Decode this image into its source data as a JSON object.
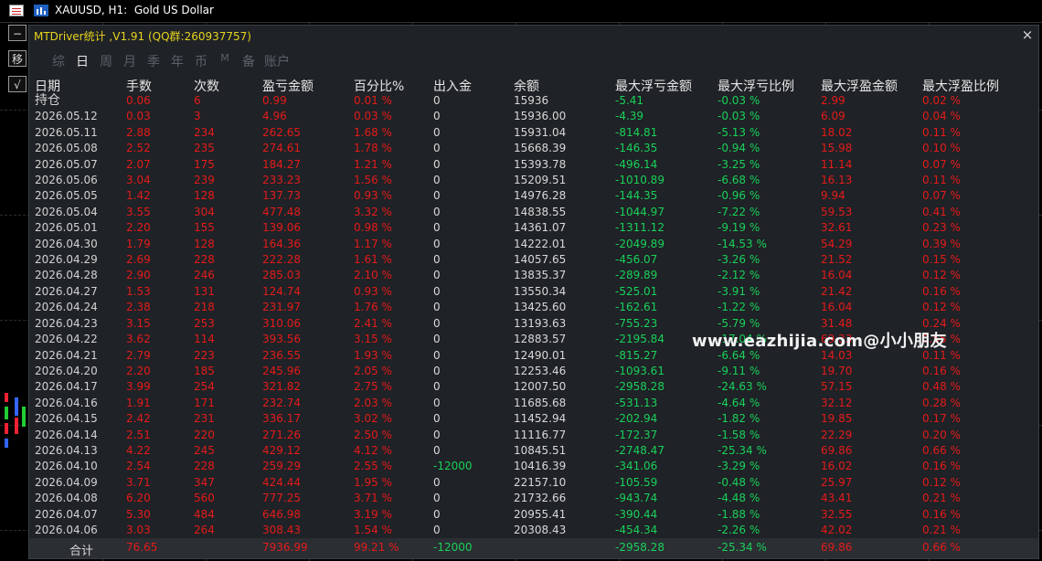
{
  "window": {
    "title": "XAUUSD, H1:  Gold US Dollar"
  },
  "sidebar_buttons": [
    "−",
    "移",
    "√"
  ],
  "panel": {
    "title": "MTDriver统计 ,V1.91 (QQ群:260937757)",
    "close_symbol": "×",
    "tabs": [
      "综",
      "日",
      "周",
      "月",
      "季",
      "年",
      "币",
      "M",
      "备",
      "账户"
    ],
    "active_tab": 1
  },
  "table": {
    "headers": [
      "日期",
      "手数",
      "次数",
      "盈亏金额",
      "百分比%",
      "出入金",
      "余额",
      "最大浮亏金额",
      "最大浮亏比例",
      "最大浮盈金额",
      "最大浮盈比例"
    ],
    "rows": [
      [
        "持仓",
        "0.06",
        "6",
        "0.99",
        "0.01 %",
        "0",
        "15936",
        "-5.41",
        "-0.03 %",
        "2.99",
        "0.02 %"
      ],
      [
        "2026.05.12",
        "0.03",
        "3",
        "4.96",
        "0.03 %",
        "0",
        "15936.00",
        "-4.39",
        "-0.03 %",
        "6.09",
        "0.04 %"
      ],
      [
        "2026.05.11",
        "2.88",
        "234",
        "262.65",
        "1.68 %",
        "0",
        "15931.04",
        "-814.81",
        "-5.13 %",
        "18.02",
        "0.11 %"
      ],
      [
        "2026.05.08",
        "2.52",
        "235",
        "274.61",
        "1.78 %",
        "0",
        "15668.39",
        "-146.35",
        "-0.94 %",
        "15.98",
        "0.10 %"
      ],
      [
        "2026.05.07",
        "2.07",
        "175",
        "184.27",
        "1.21 %",
        "0",
        "15393.78",
        "-496.14",
        "-3.25 %",
        "11.14",
        "0.07 %"
      ],
      [
        "2026.05.06",
        "3.04",
        "239",
        "233.23",
        "1.56 %",
        "0",
        "15209.51",
        "-1010.89",
        "-6.68 %",
        "16.13",
        "0.11 %"
      ],
      [
        "2026.05.05",
        "1.42",
        "128",
        "137.73",
        "0.93 %",
        "0",
        "14976.28",
        "-144.35",
        "-0.96 %",
        "9.94",
        "0.07 %"
      ],
      [
        "2026.05.04",
        "3.55",
        "304",
        "477.48",
        "3.32 %",
        "0",
        "14838.55",
        "-1044.97",
        "-7.22 %",
        "59.53",
        "0.41 %"
      ],
      [
        "2026.05.01",
        "2.20",
        "155",
        "139.06",
        "0.98 %",
        "0",
        "14361.07",
        "-1311.12",
        "-9.19 %",
        "32.61",
        "0.23 %"
      ],
      [
        "2026.04.30",
        "1.79",
        "128",
        "164.36",
        "1.17 %",
        "0",
        "14222.01",
        "-2049.89",
        "-14.53 %",
        "54.29",
        "0.39 %"
      ],
      [
        "2026.04.29",
        "2.69",
        "228",
        "222.28",
        "1.61 %",
        "0",
        "14057.65",
        "-456.07",
        "-3.26 %",
        "21.52",
        "0.15 %"
      ],
      [
        "2026.04.28",
        "2.90",
        "246",
        "285.03",
        "2.10 %",
        "0",
        "13835.37",
        "-289.89",
        "-2.12 %",
        "16.04",
        "0.12 %"
      ],
      [
        "2026.04.27",
        "1.53",
        "131",
        "124.74",
        "0.93 %",
        "0",
        "13550.34",
        "-525.01",
        "-3.91 %",
        "21.42",
        "0.16 %"
      ],
      [
        "2026.04.24",
        "2.38",
        "218",
        "231.97",
        "1.76 %",
        "0",
        "13425.60",
        "-162.61",
        "-1.22 %",
        "16.04",
        "0.12 %"
      ],
      [
        "2026.04.23",
        "3.15",
        "253",
        "310.06",
        "2.41 %",
        "0",
        "13193.63",
        "-755.23",
        "-5.79 %",
        "31.48",
        "0.24 %"
      ],
      [
        "2026.04.22",
        "3.62",
        "114",
        "393.56",
        "3.15 %",
        "0",
        "12883.57",
        "-2195.84",
        "-17.04 %",
        "69.33",
        "0.55 %"
      ],
      [
        "2026.04.21",
        "2.79",
        "223",
        "236.55",
        "1.93 %",
        "0",
        "12490.01",
        "-815.27",
        "-6.64 %",
        "14.03",
        "0.11 %"
      ],
      [
        "2026.04.20",
        "2.20",
        "185",
        "245.96",
        "2.05 %",
        "0",
        "12253.46",
        "-1093.61",
        "-9.11 %",
        "19.70",
        "0.16 %"
      ],
      [
        "2026.04.17",
        "3.99",
        "254",
        "321.82",
        "2.75 %",
        "0",
        "12007.50",
        "-2958.28",
        "-24.63 %",
        "57.15",
        "0.48 %"
      ],
      [
        "2026.04.16",
        "1.91",
        "171",
        "232.74",
        "2.03 %",
        "0",
        "11685.68",
        "-531.13",
        "-4.64 %",
        "32.12",
        "0.28 %"
      ],
      [
        "2026.04.15",
        "2.42",
        "231",
        "336.17",
        "3.02 %",
        "0",
        "11452.94",
        "-202.94",
        "-1.82 %",
        "19.85",
        "0.17 %"
      ],
      [
        "2026.04.14",
        "2.51",
        "220",
        "271.26",
        "2.50 %",
        "0",
        "11116.77",
        "-172.37",
        "-1.58 %",
        "22.29",
        "0.20 %"
      ],
      [
        "2026.04.13",
        "4.22",
        "245",
        "429.12",
        "4.12 %",
        "0",
        "10845.51",
        "-2748.47",
        "-25.34 %",
        "69.86",
        "0.66 %"
      ],
      [
        "2026.04.10",
        "2.54",
        "228",
        "259.29",
        "2.55 %",
        "-12000",
        "10416.39",
        "-341.06",
        "-3.29 %",
        "16.02",
        "0.16 %"
      ],
      [
        "2026.04.09",
        "3.71",
        "347",
        "424.44",
        "1.95 %",
        "0",
        "22157.10",
        "-105.59",
        "-0.48 %",
        "25.97",
        "0.12 %"
      ],
      [
        "2026.04.08",
        "6.20",
        "560",
        "777.25",
        "3.71 %",
        "0",
        "21732.66",
        "-943.74",
        "-4.48 %",
        "43.41",
        "0.21 %"
      ],
      [
        "2026.04.07",
        "5.30",
        "484",
        "646.98",
        "3.19 %",
        "0",
        "20955.41",
        "-390.44",
        "-1.88 %",
        "32.55",
        "0.16 %"
      ],
      [
        "2026.04.06",
        "3.03",
        "264",
        "308.43",
        "1.54 %",
        "0",
        "20308.43",
        "-454.34",
        "-2.26 %",
        "42.02",
        "0.21 %"
      ]
    ],
    "total": {
      "label": "合计",
      "lots": "76.65",
      "profit": "7936.99",
      "percent": "99.21 %",
      "deposit": "-12000",
      "max_float_loss": "-2958.28",
      "max_float_loss_pct": "-25.34 %",
      "max_float_profit": "69.86",
      "max_float_profit_pct": "0.66 %"
    }
  },
  "watermark": "www.eazhijia.com@小小朋友",
  "colors": {
    "profit_red": "#e41b1b",
    "loss_green": "#19d05a",
    "title_yellow": "#e6d31e",
    "panel_bg": "#1f2226"
  }
}
